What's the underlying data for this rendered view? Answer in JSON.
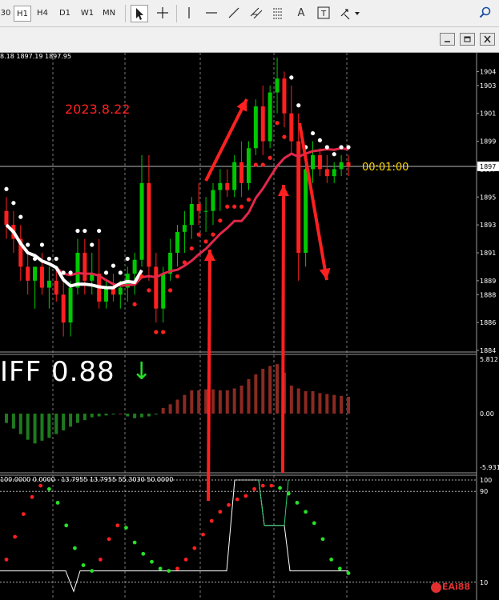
{
  "toolbar": {
    "timeframes": [
      "30",
      "H1",
      "H4",
      "D1",
      "W1",
      "MN"
    ],
    "active_timeframe": "H1",
    "tools": [
      "cursor-icon",
      "crosshair-icon",
      "vertical-line-icon",
      "horizontal-line-icon",
      "trendline-icon",
      "channel-icon",
      "fibonacci-icon",
      "text-icon",
      "label-icon",
      "arrows-icon",
      "search-icon"
    ],
    "text_tool": "A",
    "label_tool": "T"
  },
  "window_controls": [
    "minimize-icon",
    "restore-icon",
    "close-icon"
  ],
  "ohlc_text": "8.18 1897.19 1897.95",
  "annotations": {
    "date": "2023.8.22",
    "countdown": "00:01:00"
  },
  "indicator": {
    "label": "IFF 0.88",
    "arrow": "↓",
    "stoch_params": "100.0000 0.0000   13.7955 13.7955 55.3030 50.0000"
  },
  "price_axis": {
    "labels": [
      "1904",
      "1903",
      "1901",
      "1899",
      "1897",
      "1895",
      "1893",
      "1891",
      "1889",
      "1888",
      "1886",
      "1884"
    ],
    "current_price": "1897"
  },
  "indicator_axis": {
    "labels": [
      "5.812",
      "0.00",
      "-5.931"
    ]
  },
  "stoch_axis": {
    "labels": [
      "100",
      "90",
      "10"
    ]
  },
  "colors": {
    "bull": "#00c800",
    "bear": "#ff2020",
    "ma_fast": "#ffffff",
    "ma_slow": "#e0284a",
    "arrow_annot": "#ff2020",
    "countdown": "#ffd700",
    "hist_pos": "#8b2a22",
    "hist_neg": "#1e7a1e"
  },
  "watermark": "EAi88",
  "chart_data": [
    {
      "type": "candlestick",
      "ylim": [
        1884,
        1905
      ],
      "current_price": 1897.2,
      "candles": [
        [
          1894,
          1895,
          1892,
          1893
        ],
        [
          1893,
          1894,
          1891,
          1892
        ],
        [
          1892,
          1893,
          1889,
          1890
        ],
        [
          1890,
          1891,
          1888,
          1889
        ],
        [
          1889,
          1890,
          1887,
          1890
        ],
        [
          1890,
          1891,
          1888,
          1888.5
        ],
        [
          1888.5,
          1890,
          1887,
          1889
        ],
        [
          1889,
          1890,
          1887.5,
          1888
        ],
        [
          1888,
          1889,
          1885,
          1886
        ],
        [
          1886,
          1889,
          1885,
          1888.5
        ],
        [
          1888.5,
          1892,
          1888,
          1891
        ],
        [
          1891,
          1892,
          1888,
          1889
        ],
        [
          1889,
          1891,
          1888,
          1889.5
        ],
        [
          1889.5,
          1892,
          1887,
          1887.5
        ],
        [
          1887.5,
          1889,
          1887,
          1888.5
        ],
        [
          1888.5,
          1889.5,
          1887.5,
          1888
        ],
        [
          1888,
          1889,
          1887,
          1888.5
        ],
        [
          1888.5,
          1890,
          1887.5,
          1889.5
        ],
        [
          1889.5,
          1891,
          1888,
          1890.5
        ],
        [
          1890.5,
          1898,
          1890,
          1896
        ],
        [
          1896,
          1898,
          1889,
          1890
        ],
        [
          1890,
          1891,
          1886,
          1887
        ],
        [
          1887,
          1890,
          1886,
          1889.5
        ],
        [
          1889.5,
          1892,
          1889,
          1891
        ],
        [
          1891,
          1893,
          1890,
          1892.5
        ],
        [
          1892.5,
          1894,
          1891,
          1893
        ],
        [
          1893,
          1895,
          1892,
          1894.5
        ],
        [
          1894.5,
          1896,
          1893,
          1894
        ],
        [
          1894,
          1895,
          1892.5,
          1894
        ],
        [
          1894,
          1896,
          1893,
          1895.5
        ],
        [
          1895.5,
          1897,
          1894,
          1896
        ],
        [
          1896,
          1897,
          1895,
          1895.5
        ],
        [
          1895.5,
          1898,
          1895,
          1897.5
        ],
        [
          1897.5,
          1899,
          1895,
          1896
        ],
        [
          1896,
          1899,
          1895.5,
          1898.5
        ],
        [
          1898.5,
          1902,
          1898,
          1901.5
        ],
        [
          1901.5,
          1903,
          1898,
          1899
        ],
        [
          1899,
          1903,
          1898.5,
          1902.5
        ],
        [
          1902.5,
          1905,
          1901,
          1903.5
        ],
        [
          1903.5,
          1904,
          1900,
          1901
        ],
        [
          1901,
          1903,
          1898,
          1899
        ],
        [
          1899,
          1901,
          1889,
          1891
        ],
        [
          1891,
          1898,
          1890,
          1897
        ],
        [
          1897,
          1899,
          1896,
          1898
        ],
        [
          1898,
          1898.5,
          1896.5,
          1897
        ],
        [
          1897,
          1898,
          1896,
          1896.5
        ],
        [
          1896.5,
          1897.5,
          1896,
          1897
        ],
        [
          1897,
          1898,
          1896.5,
          1897.5
        ],
        [
          1897.5,
          1898,
          1896.5,
          1897.2
        ]
      ]
    },
    {
      "type": "histogram",
      "ylim": [
        -5.931,
        5.812
      ],
      "values": [
        -1.0,
        -1.6,
        -2.2,
        -2.8,
        -3.2,
        -2.9,
        -2.6,
        -2.2,
        -1.8,
        -1.4,
        -1.0,
        -0.7,
        -0.4,
        -0.3,
        -0.2,
        -0.1,
        0.0,
        -0.3,
        -0.5,
        -0.4,
        -0.3,
        -0.1,
        0.6,
        1.0,
        1.5,
        2.0,
        2.5,
        2.5,
        2.6,
        2.6,
        2.5,
        2.5,
        2.7,
        3.0,
        3.7,
        4.2,
        4.8,
        5.1,
        5.3,
        4.4,
        3.0,
        2.7,
        2.4,
        2.4,
        2.2,
        2.1,
        2.0,
        1.9,
        1.8
      ]
    },
    {
      "type": "line",
      "ylim": [
        0,
        100
      ],
      "levels": [
        100,
        90,
        10
      ],
      "series_values": [
        30,
        50,
        70,
        85,
        95,
        92,
        80,
        60,
        40,
        25,
        20,
        30,
        48,
        60,
        58,
        45,
        35,
        28,
        22,
        20,
        22,
        30,
        40,
        52,
        64,
        72,
        78,
        83,
        86,
        92,
        95,
        95,
        93,
        88,
        80,
        72,
        62,
        48,
        30,
        22,
        18
      ]
    }
  ]
}
